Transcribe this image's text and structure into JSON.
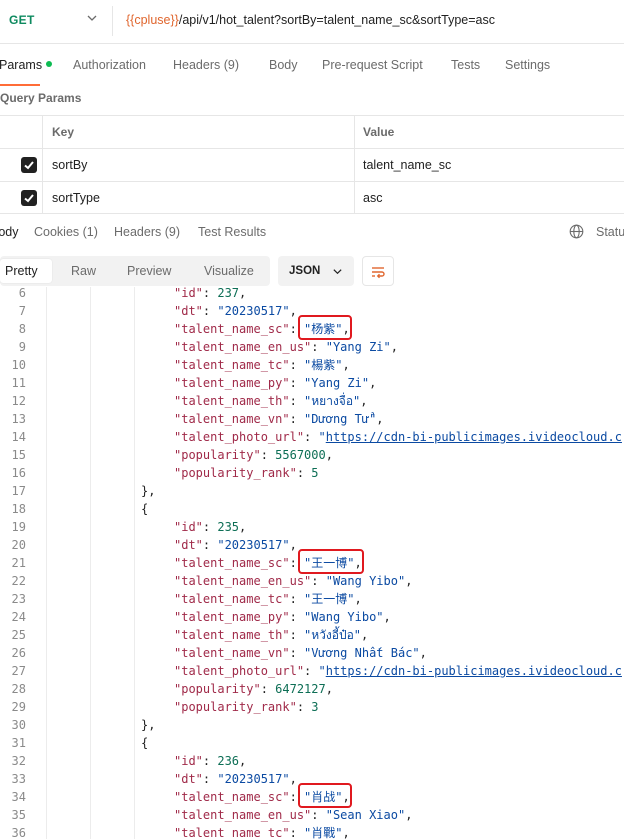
{
  "request": {
    "method": "GET",
    "url_var": "{{cpluse}}",
    "url_path": "/api/v1/hot_talent?sortBy=talent_name_sc&sortType=asc"
  },
  "request_tabs": [
    {
      "label": "Params",
      "active": true
    },
    {
      "label": "Authorization"
    },
    {
      "label": "Headers (9)"
    },
    {
      "label": "Body"
    },
    {
      "label": "Pre-request Script"
    },
    {
      "label": "Tests"
    },
    {
      "label": "Settings"
    }
  ],
  "query_params": {
    "title": "Query Params",
    "headers": {
      "key": "Key",
      "value": "Value"
    },
    "rows": [
      {
        "key": "sortBy",
        "value": "talent_name_sc",
        "checked": true
      },
      {
        "key": "sortType",
        "value": "asc",
        "checked": true
      }
    ]
  },
  "response_tabs": [
    {
      "label": "Body",
      "active": true
    },
    {
      "label": "Cookies (1)"
    },
    {
      "label": "Headers (9)"
    },
    {
      "label": "Test Results"
    }
  ],
  "status_label": "Status",
  "view_modes": [
    "Pretty",
    "Raw",
    "Preview",
    "Visualize"
  ],
  "format": "JSON",
  "code_lines": [
    {
      "n": "6",
      "indent": 5,
      "text": "\"id\": 237,"
    },
    {
      "n": "7",
      "indent": 5,
      "text": "\"dt\": \"20230517\","
    },
    {
      "n": "8",
      "indent": 5,
      "text": "\"talent_name_sc\": \"杨紫\","
    },
    {
      "n": "9",
      "indent": 5,
      "text": "\"talent_name_en_us\": \"Yang Zi\","
    },
    {
      "n": "10",
      "indent": 5,
      "text": "\"talent_name_tc\": \"楊紫\","
    },
    {
      "n": "11",
      "indent": 5,
      "text": "\"talent_name_py\": \"Yang Zi\","
    },
    {
      "n": "12",
      "indent": 5,
      "text": "\"talent_name_th\": \"หยางจื่อ\","
    },
    {
      "n": "13",
      "indent": 5,
      "text": "\"talent_name_vn\": \"Dương Tử\","
    },
    {
      "n": "14",
      "indent": 5,
      "text": "\"talent_photo_url\": \"https://cdn-bi-publicimages.ivideocloud.c"
    },
    {
      "n": "15",
      "indent": 5,
      "text": "\"popularity\": 5567000,"
    },
    {
      "n": "16",
      "indent": 5,
      "text": "\"popularity_rank\": 5"
    },
    {
      "n": "17",
      "indent": 4,
      "text": "},"
    },
    {
      "n": "18",
      "indent": 4,
      "text": "{"
    },
    {
      "n": "19",
      "indent": 5,
      "text": "\"id\": 235,"
    },
    {
      "n": "20",
      "indent": 5,
      "text": "\"dt\": \"20230517\","
    },
    {
      "n": "21",
      "indent": 5,
      "text": "\"talent_name_sc\": \"王一博\","
    },
    {
      "n": "22",
      "indent": 5,
      "text": "\"talent_name_en_us\": \"Wang Yibo\","
    },
    {
      "n": "23",
      "indent": 5,
      "text": "\"talent_name_tc\": \"王一博\","
    },
    {
      "n": "24",
      "indent": 5,
      "text": "\"talent_name_py\": \"Wang Yibo\","
    },
    {
      "n": "25",
      "indent": 5,
      "text": "\"talent_name_th\": \"หวังอี้ป๋อ\","
    },
    {
      "n": "26",
      "indent": 5,
      "text": "\"talent_name_vn\": \"Vương Nhất Bác\","
    },
    {
      "n": "27",
      "indent": 5,
      "text": "\"talent_photo_url\": \"https://cdn-bi-publicimages.ivideocloud.c"
    },
    {
      "n": "28",
      "indent": 5,
      "text": "\"popularity\": 6472127,"
    },
    {
      "n": "29",
      "indent": 5,
      "text": "\"popularity_rank\": 3"
    },
    {
      "n": "30",
      "indent": 4,
      "text": "},"
    },
    {
      "n": "31",
      "indent": 4,
      "text": "{"
    },
    {
      "n": "32",
      "indent": 5,
      "text": "\"id\": 236,"
    },
    {
      "n": "33",
      "indent": 5,
      "text": "\"dt\": \"20230517\","
    },
    {
      "n": "34",
      "indent": 5,
      "text": "\"talent_name_sc\": \"肖战\","
    },
    {
      "n": "35",
      "indent": 5,
      "text": "\"talent_name_en_us\": \"Sean Xiao\","
    },
    {
      "n": "36",
      "indent": 5,
      "text": "\"talent_name_tc\": \"肖戰\","
    }
  ],
  "highlighted_lines": [
    "8",
    "21",
    "34"
  ],
  "colors": {
    "method": "#0e8a5f",
    "url_var": "#e0662e",
    "accent": "#ff6c37",
    "json_key": "#a02a49",
    "json_string": "#0b4aa2",
    "json_number": "#0d6e55",
    "highlight": "#e0191f"
  }
}
